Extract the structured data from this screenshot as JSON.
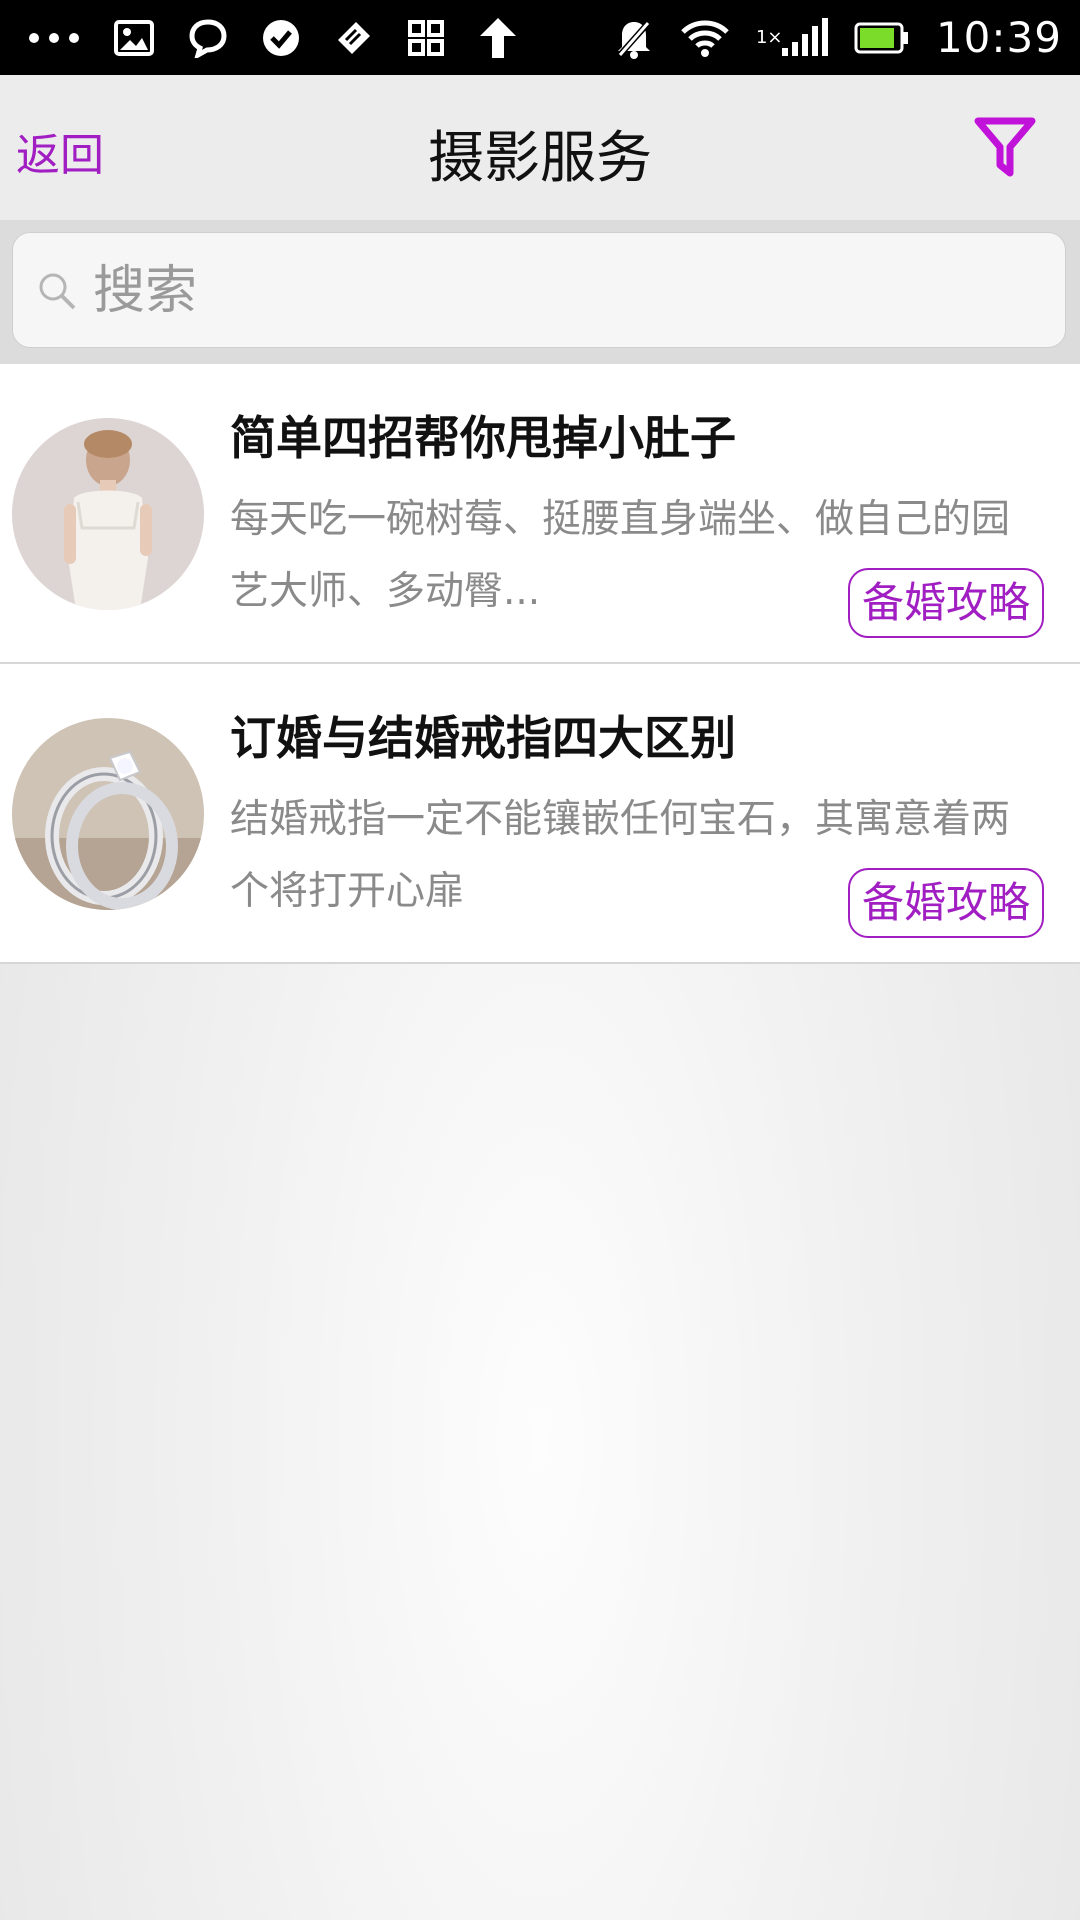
{
  "status_bar": {
    "time": "10:39",
    "network_label": "1×",
    "left_icons": [
      "more-dots-icon",
      "image-icon",
      "chat-bubble-icon",
      "check-circle-icon",
      "tag-icon",
      "apps-grid-icon",
      "upload-arrow-icon"
    ],
    "right_icons": [
      "mute-bell-icon",
      "wifi-icon",
      "signal-icon",
      "battery-icon"
    ],
    "battery_level": 0.9
  },
  "header": {
    "back_label": "返回",
    "title": "摄影服务",
    "filter_icon": "filter-icon",
    "accent_color": "#a11ec2"
  },
  "search": {
    "placeholder": "搜索",
    "value": ""
  },
  "articles": [
    {
      "title": "简单四招帮你甩掉小肚子",
      "description": "每天吃一碗树莓、挺腰直身端坐、做自己的园艺大师、多动臀...",
      "tag": "备婚攻略",
      "thumbnail": "bride-photo"
    },
    {
      "title": "订婚与结婚戒指四大区别",
      "description": "结婚戒指一定不能镶嵌任何宝石，其寓意着两个将打开心扉",
      "tag": "备婚攻略",
      "thumbnail": "rings-photo"
    }
  ]
}
